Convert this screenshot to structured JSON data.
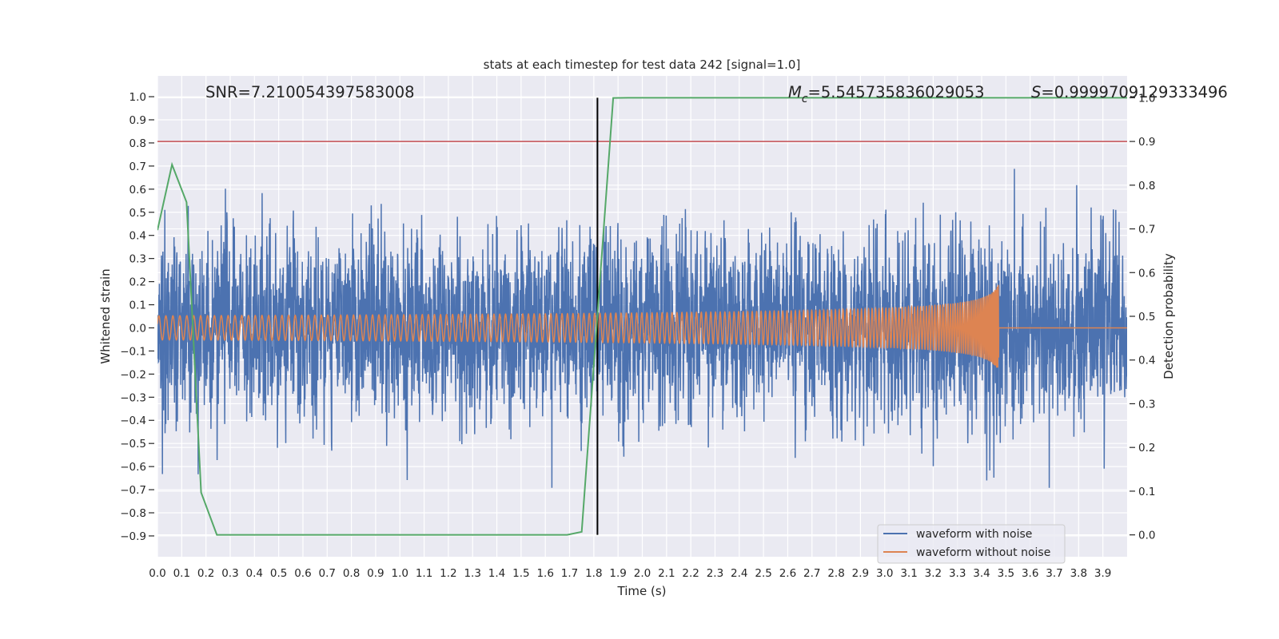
{
  "chart_data": {
    "type": "line",
    "title": "stats at each timestep for test data 242 [signal=1.0]",
    "xlabel": "Time (s)",
    "ylabel": "Whitened strain",
    "ylabel_right": "Detection probability",
    "xlim": [
      0,
      4.0
    ],
    "ylim": [
      -0.99,
      1.09
    ],
    "ylim_right": [
      -0.05,
      1.05
    ],
    "grid": true,
    "background": "#EAEAF2",
    "xticks": [
      "0.0",
      "0.1",
      "0.2",
      "0.3",
      "0.4",
      "0.5",
      "0.6",
      "0.7",
      "0.8",
      "0.9",
      "1.0",
      "1.1",
      "1.2",
      "1.3",
      "1.4",
      "1.5",
      "1.6",
      "1.7",
      "1.8",
      "1.9",
      "2.0",
      "2.1",
      "2.2",
      "2.3",
      "2.4",
      "2.5",
      "2.6",
      "2.7",
      "2.8",
      "2.9",
      "3.0",
      "3.1",
      "3.2",
      "3.3",
      "3.4",
      "3.5",
      "3.6",
      "3.7",
      "3.8",
      "3.9"
    ],
    "yticks": [
      "1.0",
      "0.9",
      "0.8",
      "0.7",
      "0.6",
      "0.5",
      "0.4",
      "0.3",
      "0.2",
      "0.1",
      "0.0",
      "−0.1",
      "−0.2",
      "−0.3",
      "−0.4",
      "−0.5",
      "−0.6",
      "−0.7",
      "−0.8",
      "−0.9"
    ],
    "yticks_right": [
      "1.0",
      "0.9",
      "0.8",
      "0.7",
      "0.6",
      "0.5",
      "0.4",
      "0.3",
      "0.2",
      "0.1",
      "0.0"
    ],
    "annotations": {
      "snr": "SNR=7.210054397583008",
      "mc_symbol": "M",
      "mc_subscript": "c",
      "mc_value": "=5.545735836029053",
      "s_symbol": "S",
      "s_value": "=0.9999709129333496"
    },
    "legend": {
      "placement": "lower-right",
      "entries": [
        {
          "label": "waveform with noise",
          "color": "#4C72B0"
        },
        {
          "label": "waveform without noise",
          "color": "#DD8452"
        }
      ]
    },
    "series": [
      {
        "name": "waveform with noise",
        "axis": "left",
        "color": "#4C72B0",
        "description_values": "noisy strain, range approx -0.9 to 1.0"
      },
      {
        "name": "waveform without noise",
        "axis": "left",
        "color": "#DD8452",
        "chirp_amplitude_start": 0.025,
        "chirp_amplitude_end": 0.19,
        "chirp_end_time": 3.47
      },
      {
        "axis": "right",
        "color": "#55A868",
        "x": [
          0.0,
          0.06,
          0.12,
          0.18,
          0.245,
          1.69,
          1.75,
          1.88,
          1.94,
          4.0
        ],
        "y": [
          0.697,
          0.847,
          0.761,
          0.097,
          0.0,
          0.0,
          0.007,
          0.9995,
          1.0,
          1.0
        ]
      }
    ],
    "threshold": {
      "axis": "right",
      "value": 0.9,
      "color": "#C44E52"
    },
    "vertical_marker": {
      "x": 1.815,
      "color": "#000000"
    }
  }
}
